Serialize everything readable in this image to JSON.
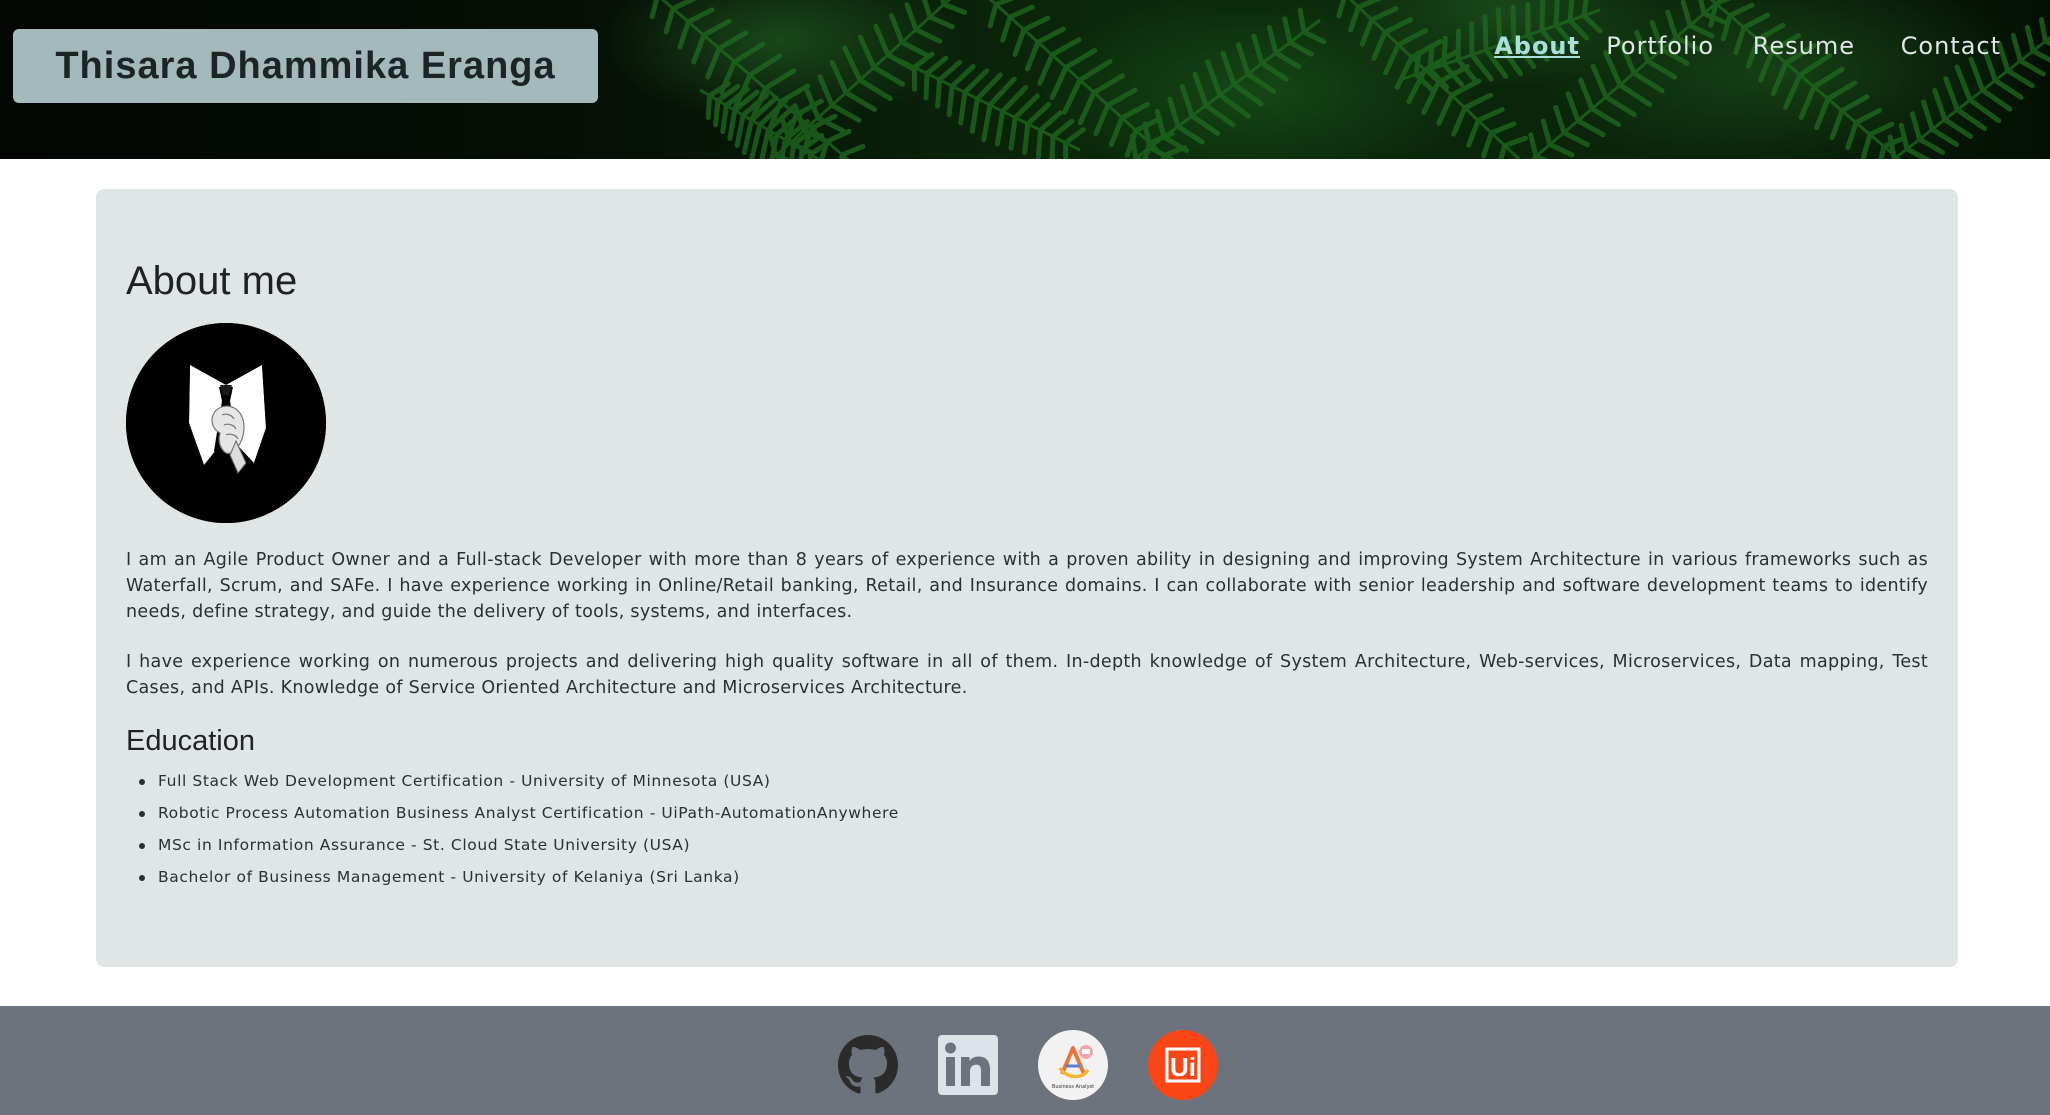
{
  "header": {
    "brand_name": "Thisara Dhammika Eranga",
    "nav": [
      {
        "label": "About",
        "active": true
      },
      {
        "label": "Portfolio",
        "active": false
      },
      {
        "label": "Resume",
        "active": false
      },
      {
        "label": "Contact",
        "active": false
      }
    ]
  },
  "about": {
    "title": "About me",
    "avatar_icon": "suit-tie-avatar-icon",
    "paragraphs": [
      "I am an Agile Product Owner and a Full-stack Developer with more than 8 years of experience with a proven ability in designing and improving System Architecture in various frameworks such as Waterfall, Scrum, and SAFe. I have experience working in Online/Retail banking, Retail, and Insurance domains. I can collaborate with senior leadership and software development teams to identify needs, define strategy, and guide the delivery of tools, systems, and interfaces.",
      "I have experience working on numerous projects and delivering high quality software in all of them. In-depth knowledge of System Architecture, Web-services, Microservices, Data mapping, Test Cases, and APIs. Knowledge of Service Oriented Architecture and Microservices Architecture."
    ]
  },
  "education": {
    "title": "Education",
    "items": [
      "Full Stack Web Development Certification - University of Minnesota (USA)",
      "Robotic Process Automation Business Analyst Certification - UiPath-AutomationAnywhere",
      "MSc in Information Assurance - St. Cloud State University (USA)",
      "Bachelor of Business Management - University of Kelaniya (Sri Lanka)"
    ]
  },
  "footer": {
    "social_icons": [
      "github-icon",
      "linkedin-icon",
      "business-analyst-badge-icon",
      "uipath-icon"
    ],
    "badge_caption": "Business Analyst",
    "uipath_label": "Ui"
  },
  "colors": {
    "brand_box": "#a4b9b9",
    "nav_active": "#a9e0dc",
    "card_bg": "#e0e6e6",
    "footer_bg": "#6c737c",
    "uipath_orange": "#fa4616"
  }
}
